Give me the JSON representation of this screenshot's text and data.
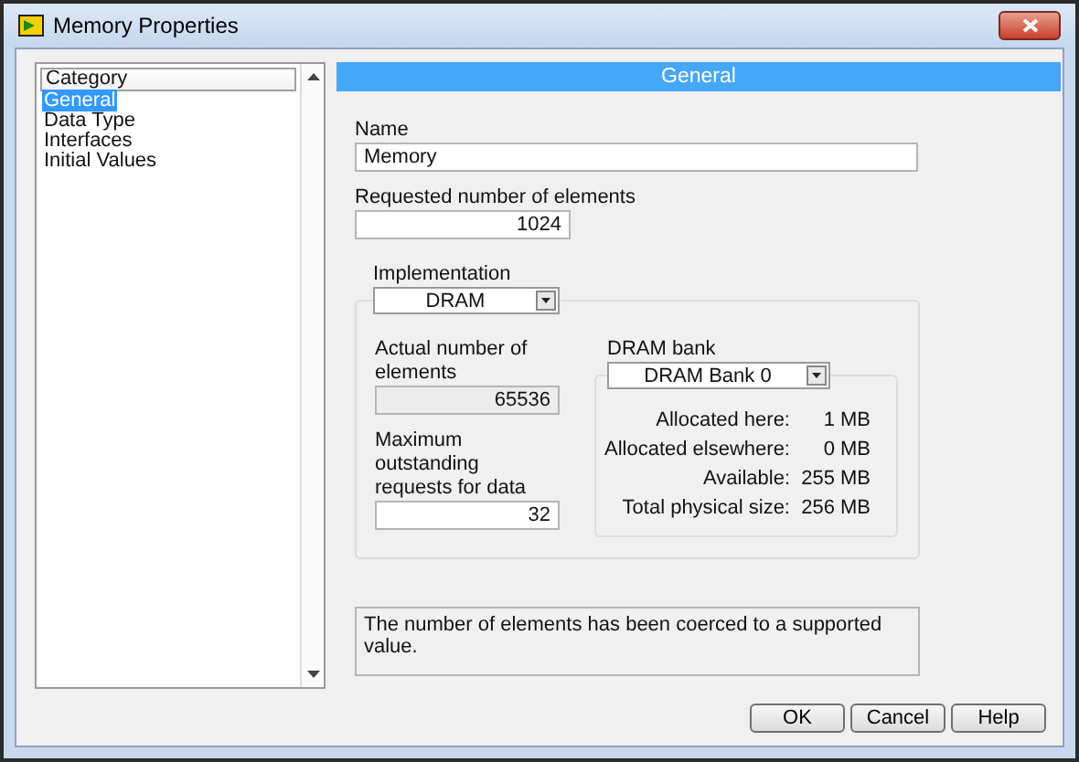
{
  "window": {
    "title": "Memory Properties"
  },
  "sidebar": {
    "header": "Category",
    "items": [
      {
        "label": "General",
        "selected": true
      },
      {
        "label": "Data Type",
        "selected": false
      },
      {
        "label": "Interfaces",
        "selected": false
      },
      {
        "label": "Initial Values",
        "selected": false
      }
    ]
  },
  "panel": {
    "heading": "General",
    "name": {
      "label": "Name",
      "value": "Memory"
    },
    "requested": {
      "label": "Requested number of elements",
      "value": "1024"
    },
    "implementation": {
      "label": "Implementation",
      "value": "DRAM"
    },
    "actual": {
      "label": "Actual number of elements",
      "value": "65536",
      "read_only": true
    },
    "max_requests": {
      "label": "Maximum outstanding requests for data",
      "value": "32",
      "read_only": false
    },
    "dram_bank": {
      "label": "DRAM bank",
      "value": "DRAM Bank 0",
      "stats": [
        {
          "label": "Allocated here:",
          "value": "1 MB"
        },
        {
          "label": "Allocated elsewhere:",
          "value": "0 MB"
        },
        {
          "label": "Available:",
          "value": "255 MB"
        },
        {
          "label": "Total physical size:",
          "value": "256 MB"
        }
      ]
    },
    "message": "The number of elements has been coerced to a supported value."
  },
  "buttons": [
    "OK",
    "Cancel",
    "Help"
  ]
}
